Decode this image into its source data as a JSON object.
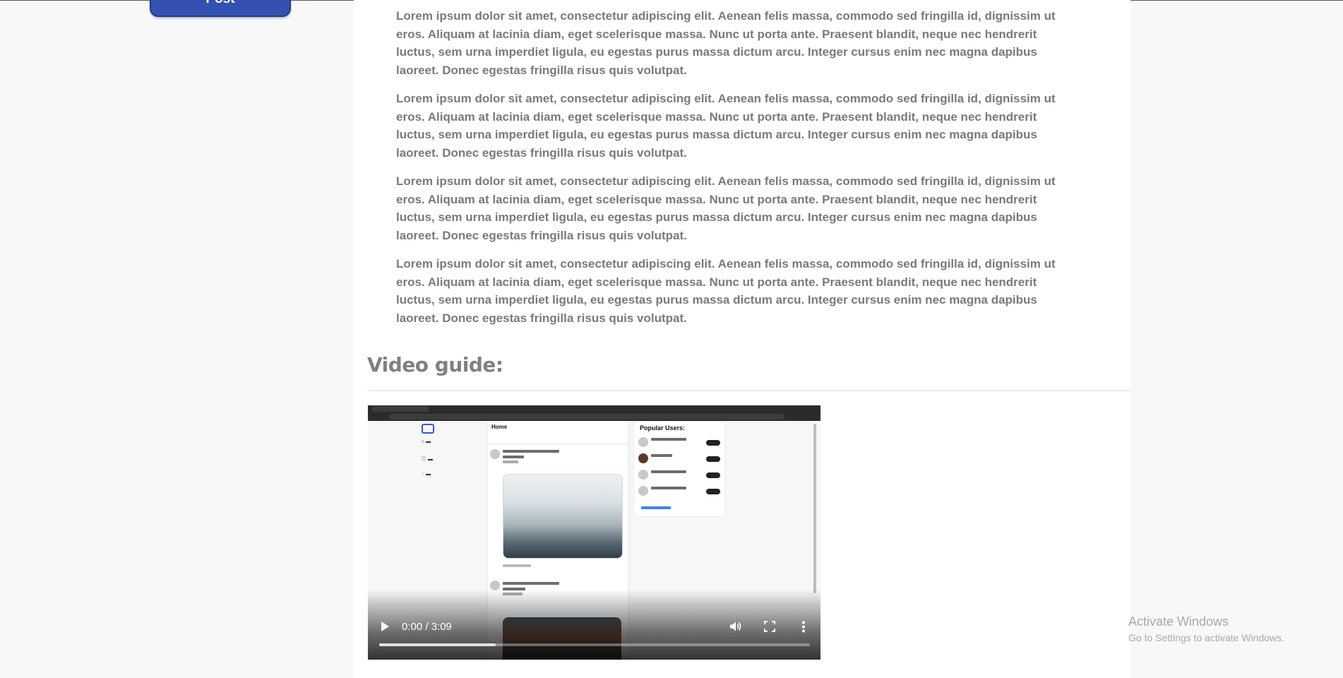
{
  "top": {
    "post_button_label": "Post"
  },
  "content": {
    "paragraphs": [
      "Lorem ipsum dolor sit amet, consectetur adipiscing elit. Aenean felis massa, commodo sed fringilla id, dignissim ut eros. Aliquam at lacinia diam, eget scelerisque massa. Nunc ut porta ante. Praesent blandit, neque nec hendrerit luctus, sem urna imperdiet ligula, eu egestas purus massa dictum arcu. Integer cursus enim nec magna dapibus laoreet. Donec egestas fringilla risus quis volutpat.",
      "Lorem ipsum dolor sit amet, consectetur adipiscing elit. Aenean felis massa, commodo sed fringilla id, dignissim ut eros. Aliquam at lacinia diam, eget scelerisque massa. Nunc ut porta ante. Praesent blandit, neque nec hendrerit luctus, sem urna imperdiet ligula, eu egestas purus massa dictum arcu. Integer cursus enim nec magna dapibus laoreet. Donec egestas fringilla risus quis volutpat.",
      "Lorem ipsum dolor sit amet, consectetur adipiscing elit. Aenean felis massa, commodo sed fringilla id, dignissim ut eros. Aliquam at lacinia diam, eget scelerisque massa. Nunc ut porta ante. Praesent blandit, neque nec hendrerit luctus, sem urna imperdiet ligula, eu egestas purus massa dictum arcu. Integer cursus enim nec magna dapibus laoreet. Donec egestas fringilla risus quis volutpat.",
      "Lorem ipsum dolor sit amet, consectetur adipiscing elit. Aenean felis massa, commodo sed fringilla id, dignissim ut eros. Aliquam at lacinia diam, eget scelerisque massa. Nunc ut porta ante. Praesent blandit, neque nec hendrerit luctus, sem urna imperdiet ligula, eu egestas purus massa dictum arcu. Integer cursus enim nec magna dapibus laoreet. Donec egestas fringilla risus quis volutpat."
    ],
    "section_title": "Video guide:"
  },
  "video": {
    "time_display": "0:00 / 3:09",
    "progress_fraction": 0.27,
    "inner_screen": {
      "feed_title": "Home",
      "popular_title": "Popular Users:"
    },
    "icons": [
      "play-icon",
      "volume-icon",
      "fullscreen-icon",
      "more-vertical-icon"
    ]
  },
  "watermark": {
    "title": "Activate Windows",
    "subtitle": "Go to Settings to activate Windows."
  },
  "colors": {
    "post_button": "#3451b2",
    "page_background": "#f8f8f8",
    "content_background": "#ffffff",
    "paragraph_text": "#7a7a7a",
    "title_text": "#808080"
  }
}
